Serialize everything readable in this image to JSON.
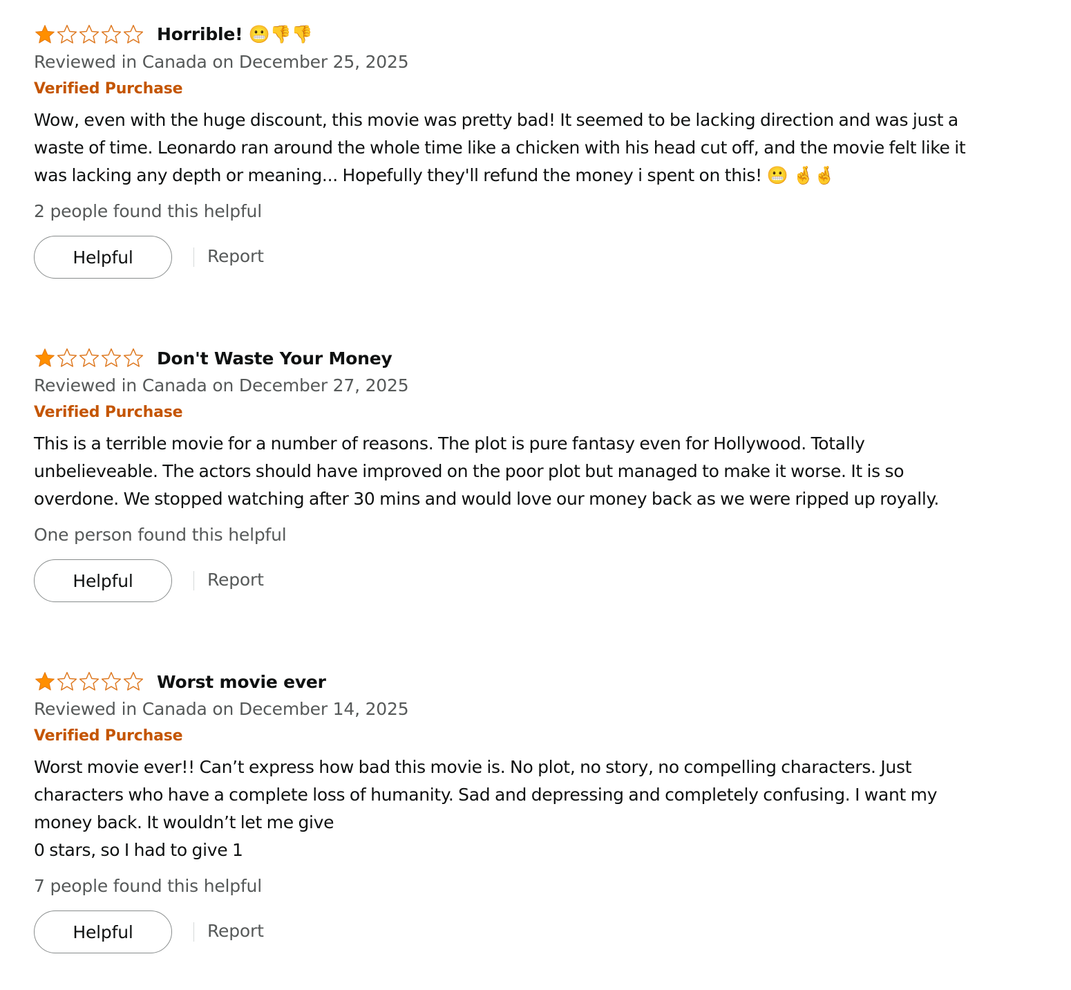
{
  "colors": {
    "star_filled": "#ff8f00",
    "star_outline": "#de7921",
    "verified": "#c45500",
    "secondary_text": "#565959",
    "primary_text": "#0f1111",
    "button_border": "#888c8c"
  },
  "reviews": [
    {
      "rating": 1,
      "rating_max": 5,
      "title": "Horrible! 😬👎👎",
      "date": "Reviewed in Canada on December 25, 2025",
      "verified": "Verified Purchase",
      "body": [
        "Wow, even with the huge discount, this movie was pretty bad! It seemed to be lacking direction and was just a waste of time. Leonardo ran around the whole time like a chicken with his head cut off, and the movie felt like it was lacking any depth or meaning... Hopefully they'll refund the money i spent on this! 😬 🤞🤞"
      ],
      "helpful_text": "2 people found this helpful",
      "helpful_button": "Helpful",
      "report_link": "Report"
    },
    {
      "rating": 1,
      "rating_max": 5,
      "title": "Don't Waste Your Money",
      "date": "Reviewed in Canada on December 27, 2025",
      "verified": "Verified Purchase",
      "body": [
        "This is a terrible movie for a number of reasons. The plot is pure fantasy even for Hollywood. Totally unbelieveable. The actors should have improved on the poor plot but managed to make it worse. It is so overdone. We stopped watching after 30 mins and would love our money back as we were ripped up royally."
      ],
      "helpful_text": "One person found this helpful",
      "helpful_button": "Helpful",
      "report_link": "Report"
    },
    {
      "rating": 1,
      "rating_max": 5,
      "title": "Worst movie ever",
      "date": "Reviewed in Canada on December 14, 2025",
      "verified": "Verified Purchase",
      "body": [
        "Worst movie ever!! Can’t express how bad this movie is. No plot, no story, no compelling characters. Just characters who have a complete loss of humanity. Sad and depressing and completely confusing. I want my money back. It wouldn’t let me give",
        "0 stars, so I had to give 1"
      ],
      "helpful_text": "7 people found this helpful",
      "helpful_button": "Helpful",
      "report_link": "Report"
    }
  ]
}
